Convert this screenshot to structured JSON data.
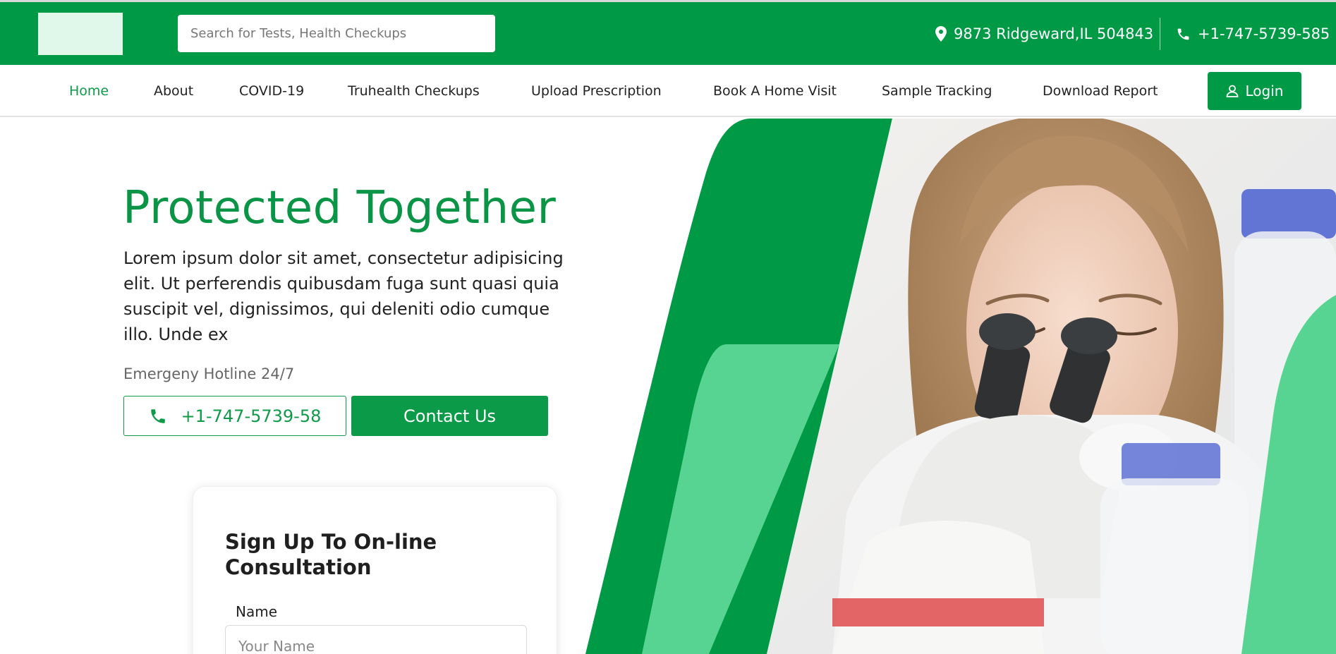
{
  "header": {
    "search_placeholder": "Search for Tests, Health Checkups",
    "address": "9873 Ridgeward,IL 504843",
    "phone": "+1-747-5739-585",
    "icons": {
      "location": "location-pin-icon",
      "phone": "phone-icon"
    }
  },
  "nav": {
    "items": [
      "Home",
      "About",
      "COVID-19",
      "Truhealth Checkups",
      "Upload Prescription",
      "Book A Home Visit",
      "Sample Tracking",
      "Download Report"
    ],
    "active": "Home",
    "login_label": "Login",
    "login_icon": "user-icon"
  },
  "hero": {
    "title": "Protected Together",
    "text": "Lorem ipsum dolor sit amet, consectetur adipisicing elit. Ut perferendis quibusdam fuga sunt quasi quia suscipit vel, dignissimos, qui deleniti odio cumque illo. Unde ex",
    "hotline_label": "Emergeny Hotline 24/7",
    "hotline_phone": "+1-747-5739-58",
    "contact_label": "Contact Us"
  },
  "signup": {
    "title": "Sign Up To On-line Consultation",
    "name_label": "Name",
    "name_placeholder": "Your Name"
  },
  "colors": {
    "brand_green": "#009a47",
    "light_green": "#57d491",
    "logo_placeholder": "#dff8ea"
  }
}
